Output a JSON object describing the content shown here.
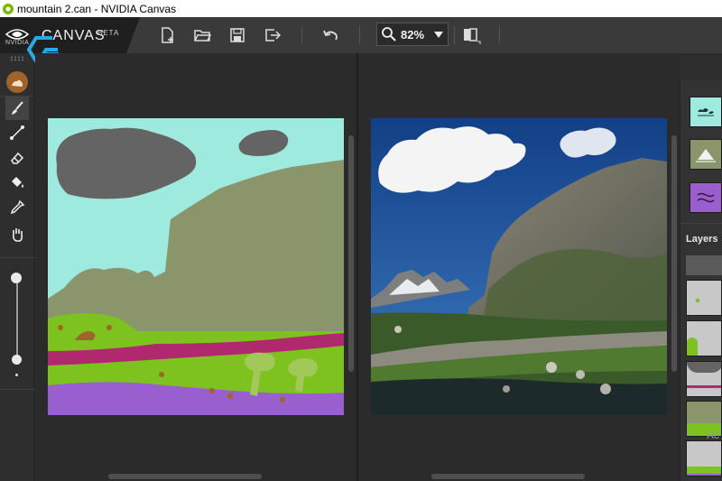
{
  "window": {
    "title": "mountain 2.can - NVIDIA Canvas"
  },
  "brand": {
    "company": "NVIDIA",
    "app_name": "CANVAS",
    "badge": "BETA"
  },
  "toolbar": {
    "buttons": [
      "new-file",
      "open-folder",
      "save",
      "export",
      "undo",
      "compare"
    ],
    "zoom_value": "82%"
  },
  "tools": [
    "brush",
    "line",
    "eraser",
    "fill",
    "eyedropper",
    "pan"
  ],
  "layers": {
    "label": "Layers"
  },
  "hint": {
    "text": "Ac"
  },
  "colors": {
    "sky": "#9eeadf",
    "cloud": "#646464",
    "mountain": "#8a956c",
    "grass": "#7dc21e",
    "wall": "#b0286e",
    "water": "#9a5fcf",
    "dirt": "#a0642a",
    "accent": "#76b900"
  }
}
